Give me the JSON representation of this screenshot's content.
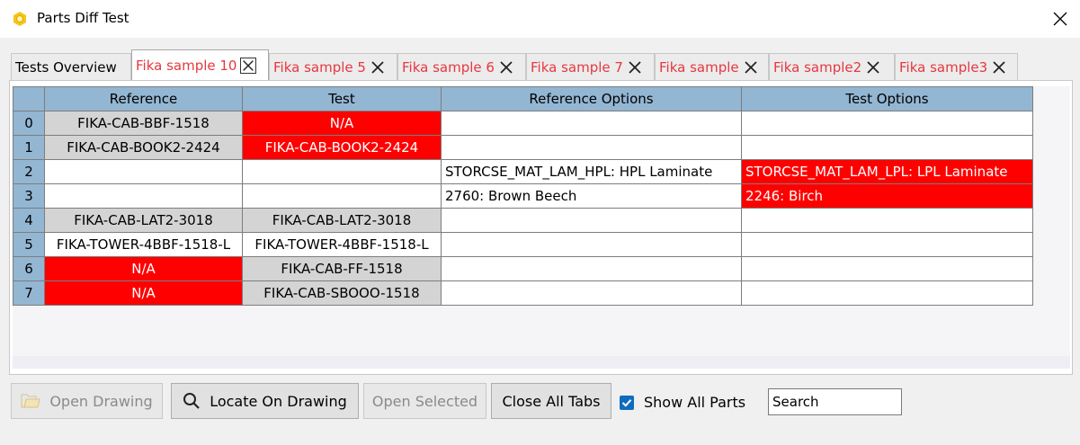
{
  "window": {
    "title": "Parts Diff Test"
  },
  "tabs": [
    {
      "label": "Tests Overview"
    },
    {
      "label": "Fika sample 10"
    },
    {
      "label": "Fika sample 5"
    },
    {
      "label": "Fika sample 6"
    },
    {
      "label": "Fika sample 7"
    },
    {
      "label": "Fika sample"
    },
    {
      "label": "Fika sample2"
    },
    {
      "label": "Fika sample3"
    }
  ],
  "grid": {
    "headers": [
      "Reference",
      "Test",
      "Reference Options",
      "Test Options"
    ],
    "rows": [
      {
        "index": "0",
        "reference": "FIKA-CAB-BBF-1518",
        "test": "N/A",
        "reference_options": "",
        "test_options": ""
      },
      {
        "index": "1",
        "reference": "FIKA-CAB-BOOK2-2424",
        "test": "FIKA-CAB-BOOK2-2424",
        "reference_options": "",
        "test_options": ""
      },
      {
        "index": "2",
        "reference": "",
        "test": "",
        "reference_options": "STORCSE_MAT_LAM_HPL: HPL Laminate",
        "test_options": "STORCSE_MAT_LAM_LPL: LPL Laminate"
      },
      {
        "index": "3",
        "reference": "",
        "test": "",
        "reference_options": "2760: Brown Beech",
        "test_options": "2246: Birch"
      },
      {
        "index": "4",
        "reference": "FIKA-CAB-LAT2-3018",
        "test": "FIKA-CAB-LAT2-3018",
        "reference_options": "",
        "test_options": ""
      },
      {
        "index": "5",
        "reference": "FIKA-TOWER-4BBF-1518-L",
        "test": "FIKA-TOWER-4BBF-1518-L",
        "reference_options": "",
        "test_options": ""
      },
      {
        "index": "6",
        "reference": "N/A",
        "test": "FIKA-CAB-FF-1518",
        "reference_options": "",
        "test_options": ""
      },
      {
        "index": "7",
        "reference": "N/A",
        "test": "FIKA-CAB-SBOOO-1518",
        "reference_options": "",
        "test_options": ""
      }
    ]
  },
  "toolbar": {
    "open_drawing": "Open Drawing",
    "locate_on_drawing": "Locate On Drawing",
    "open_selected": "Open Selected",
    "close_all_tabs": "Close All Tabs",
    "show_all_parts": "Show All Parts",
    "show_all_parts_checked": true,
    "search_value": "Search"
  },
  "colors": {
    "diff_red": "#ff0000",
    "match_gray": "#d4d4d4",
    "header_blue": "#93b6d3",
    "tab_text_red": "#e8373f"
  }
}
